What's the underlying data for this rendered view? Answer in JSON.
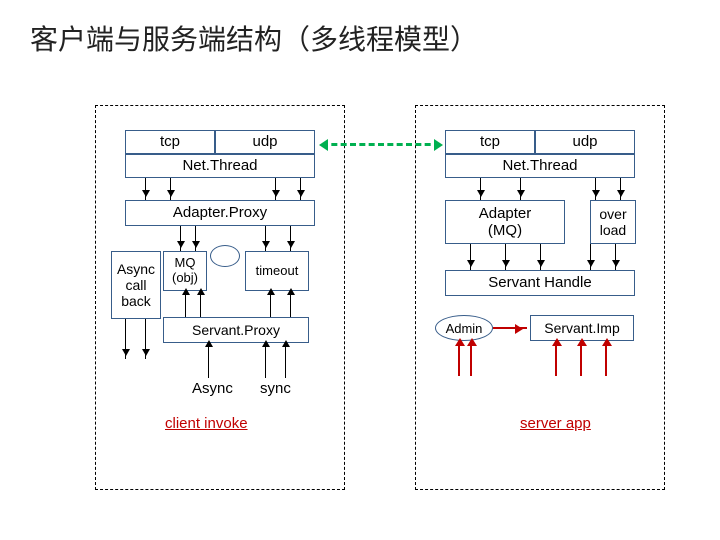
{
  "title": "客户端与服务端结构（多线程模型）",
  "client": {
    "tcp": "tcp",
    "udp": "udp",
    "netthread": "Net.Thread",
    "adapter_proxy": "Adapter.Proxy",
    "async_callback": "Async\ncall\nback",
    "mq": "MQ\n(obj)",
    "timeout": "timeout",
    "servant_proxy": "Servant.Proxy",
    "async_label": "Async",
    "sync_label": "sync",
    "invoke": "client invoke"
  },
  "server": {
    "tcp": "tcp",
    "udp": "udp",
    "netthread": "Net.Thread",
    "adapter_mq": "Adapter\n(MQ)",
    "overload": "over\nload",
    "servant_handle": "Servant Handle",
    "admin": "Admin",
    "servant_imp": "Servant.Imp",
    "app": "server app"
  }
}
